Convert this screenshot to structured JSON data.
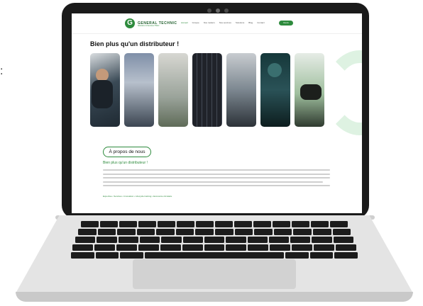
{
  "site": {
    "logo_initial": "G",
    "logo_name": "GENERAL TECHNIC",
    "logo_tagline": "Solutions & Services HVAC",
    "nav": [
      "Accueil",
      "Groupe",
      "Nos métiers",
      "Nos services",
      "Solutions",
      "Blog",
      "Contact"
    ],
    "cta_label": "Devis",
    "headline": "Bien plus qu'un distributeur !",
    "about_button": "À propos de nous",
    "subheading": "Bien plus qu'un distributeur !",
    "keywords": "Expertise • Services • Innovation • Lifecycle training • Economie circulaire"
  },
  "photos": [
    {
      "subject": "technician-at-computer"
    },
    {
      "subject": "building-facade"
    },
    {
      "subject": "outdoor-units-rooftop"
    },
    {
      "subject": "solar-panel"
    },
    {
      "subject": "warehouse-stock"
    },
    {
      "subject": "technician-back"
    },
    {
      "subject": "hand-holding-device"
    }
  ],
  "colors": {
    "brand": "#2e8b3d",
    "bezel": "#1a1a1a",
    "chassis": "#e4e4e4"
  }
}
